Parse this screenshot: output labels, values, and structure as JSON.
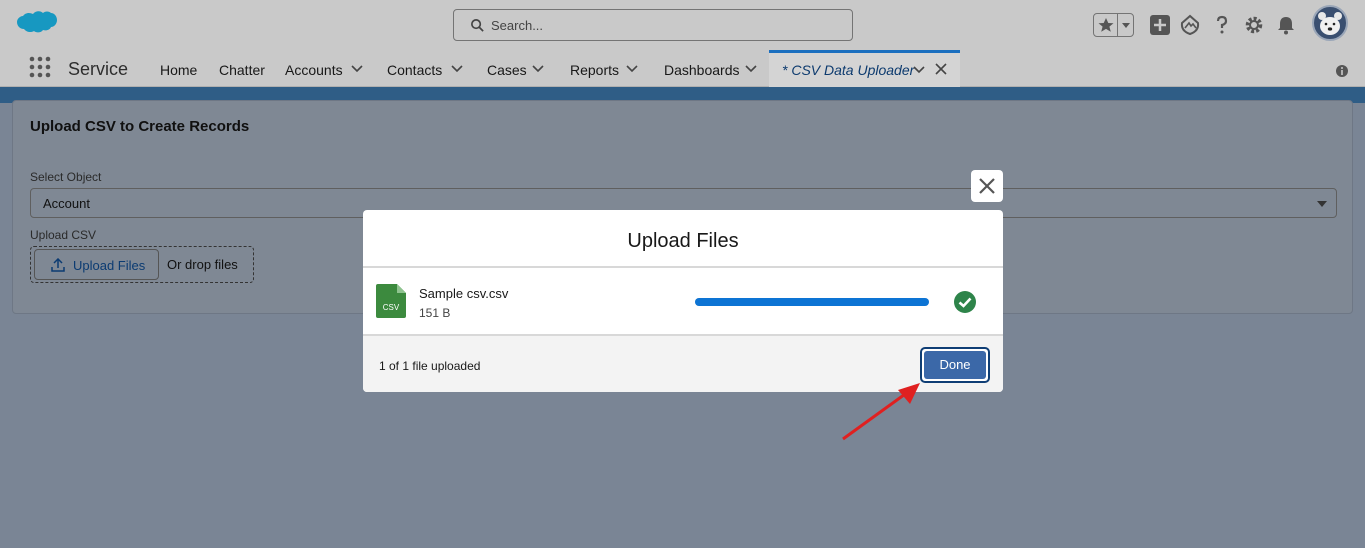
{
  "header": {
    "search_placeholder": "Search..."
  },
  "nav": {
    "app_name": "Service",
    "items": [
      {
        "label": "Home"
      },
      {
        "label": "Chatter"
      },
      {
        "label": "Accounts"
      },
      {
        "label": "Contacts"
      },
      {
        "label": "Cases"
      },
      {
        "label": "Reports"
      },
      {
        "label": "Dashboards"
      }
    ],
    "active_tab": "* CSV Data Uploader"
  },
  "card": {
    "title": "Upload CSV to Create Records",
    "select_label": "Select Object",
    "select_value": "Account",
    "upload_label": "Upload CSV",
    "upload_button": "Upload Files",
    "drop_text": "Or drop files"
  },
  "modal": {
    "title": "Upload Files",
    "file": {
      "name": "Sample csv.csv",
      "size": "151 B",
      "type_label": "CSV",
      "progress": 1.0
    },
    "footer_status": "1 of 1 file uploaded",
    "done_label": "Done"
  },
  "colors": {
    "brand": "#0d74d4",
    "success": "#2e844a",
    "done_button": "#3b68a8",
    "annotation_arrow": "#e02020"
  }
}
